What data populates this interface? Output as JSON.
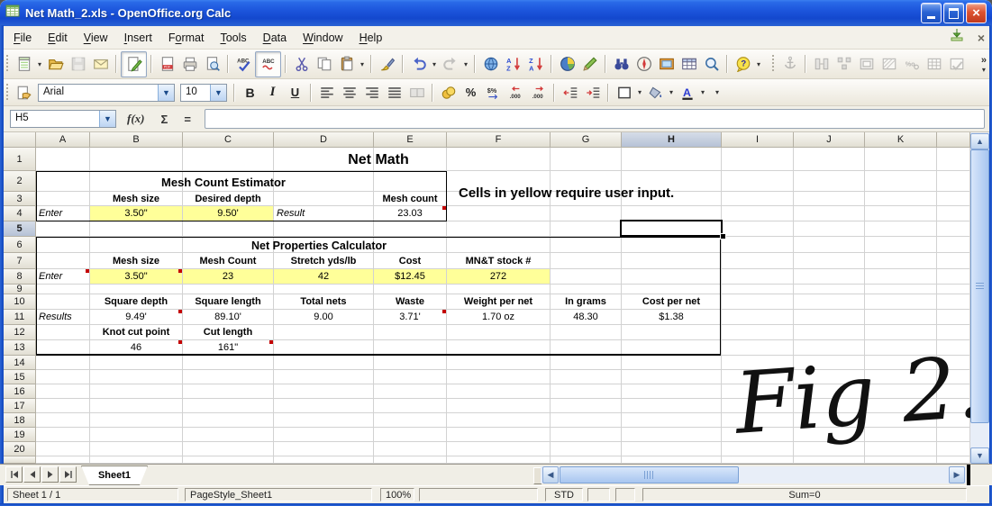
{
  "window": {
    "title": "Net Math_2.xls - OpenOffice.org Calc"
  },
  "titlebar": {
    "buttons": [
      "minimize",
      "maximize",
      "close"
    ]
  },
  "menu": {
    "items": [
      {
        "label": "File",
        "accel": 0
      },
      {
        "label": "Edit",
        "accel": 0
      },
      {
        "label": "View",
        "accel": 0
      },
      {
        "label": "Insert",
        "accel": 0
      },
      {
        "label": "Format",
        "accel": 1
      },
      {
        "label": "Tools",
        "accel": 0
      },
      {
        "label": "Data",
        "accel": 0
      },
      {
        "label": "Window",
        "accel": 0
      },
      {
        "label": "Help",
        "accel": 0
      }
    ]
  },
  "standard_toolbar": {
    "icons": [
      "new-document",
      "open",
      "save",
      "email",
      "edit-file",
      "export-pdf",
      "print",
      "page-preview",
      "spellcheck",
      "auto-spellcheck",
      "cut",
      "copy",
      "paste",
      "format-paintbrush",
      "undo",
      "redo",
      "hyperlink",
      "sort-ascending",
      "sort-descending",
      "insert-chart",
      "show-draw-functions",
      "find-replace",
      "navigator",
      "gallery",
      "data-sources",
      "zoom",
      "help"
    ],
    "disabled_icons": [
      "anchor",
      "insert-columns",
      "group",
      "insert-frame",
      "hatching",
      "decimals",
      "table",
      "design-mode"
    ]
  },
  "formatting_toolbar": {
    "font_name": "Arial",
    "font_size": "10",
    "bold_label": "B",
    "italic_label": "I",
    "underline_label": "U",
    "percent_label": "%",
    "icons": [
      "styles",
      "font-name",
      "font-size",
      "bold",
      "italic",
      "underline",
      "align-left",
      "align-center",
      "align-right",
      "justified",
      "merge-cells",
      "currency",
      "percent",
      "number-format-standard",
      "add-decimal",
      "delete-decimal",
      "decrease-indent",
      "increase-indent",
      "borders",
      "background-color",
      "font-color"
    ]
  },
  "formula_bar": {
    "cell_reference": "H5",
    "fx_label": "f(x)",
    "sum_label": "Σ",
    "equals_label": "=",
    "formula": ""
  },
  "grid": {
    "column_headers": [
      "A",
      "B",
      "C",
      "D",
      "E",
      "F",
      "G",
      "H",
      "I",
      "J",
      "K"
    ],
    "row_headers": [
      "1",
      "2",
      "3",
      "4",
      "5",
      "6",
      "7",
      "8",
      "9",
      "10",
      "11",
      "12",
      "13",
      "14",
      "15",
      "16",
      "17",
      "18",
      "19",
      "20"
    ],
    "selected_cell": "H5",
    "selected_column": "H",
    "selected_row": "5"
  },
  "sheet_content": {
    "net_math_title": "Net Math",
    "estimator_title": "Mesh Count Estimator",
    "calculator_title": "Net Properties Calculator",
    "note": "Cells in yellow require user input.",
    "figure_label": "Fig 2.",
    "cells": [
      {
        "ref": "B3",
        "text": "Mesh size",
        "bold": true
      },
      {
        "ref": "C3",
        "text": "Desired depth",
        "bold": true
      },
      {
        "ref": "E3",
        "text": "Mesh count",
        "bold": true
      },
      {
        "ref": "A4",
        "text": "Enter",
        "italic": true,
        "align": "left"
      },
      {
        "ref": "B4",
        "text": "3.50\"",
        "yellow": true
      },
      {
        "ref": "C4",
        "text": "9.50'",
        "yellow": true
      },
      {
        "ref": "D4",
        "text": "Result",
        "italic": true,
        "align": "left"
      },
      {
        "ref": "E4",
        "text": "23.03",
        "comment": true
      },
      {
        "ref": "B7",
        "text": "Mesh size",
        "bold": true
      },
      {
        "ref": "C7",
        "text": "Mesh Count",
        "bold": true
      },
      {
        "ref": "D7",
        "text": "Stretch yds/lb",
        "bold": true
      },
      {
        "ref": "E7",
        "text": "Cost",
        "bold": true
      },
      {
        "ref": "F7",
        "text": "MN&T stock #",
        "bold": true
      },
      {
        "ref": "A8",
        "text": "Enter",
        "italic": true,
        "align": "left",
        "comment": true
      },
      {
        "ref": "B8",
        "text": "3.50\"",
        "yellow": true,
        "comment": true
      },
      {
        "ref": "C8",
        "text": "23",
        "yellow": true
      },
      {
        "ref": "D8",
        "text": "42",
        "yellow": true
      },
      {
        "ref": "E8",
        "text": "$12.45",
        "yellow": true
      },
      {
        "ref": "F8",
        "text": "272",
        "yellow": true
      },
      {
        "ref": "B10",
        "text": "Square depth",
        "bold": true
      },
      {
        "ref": "C10",
        "text": "Square length",
        "bold": true
      },
      {
        "ref": "D10",
        "text": "Total nets",
        "bold": true
      },
      {
        "ref": "E10",
        "text": "Waste",
        "bold": true
      },
      {
        "ref": "F10",
        "text": "Weight per net",
        "bold": true
      },
      {
        "ref": "G10",
        "text": "In grams",
        "bold": true
      },
      {
        "ref": "H10",
        "text": "Cost per net",
        "bold": true
      },
      {
        "ref": "A11",
        "text": "Results",
        "italic": true,
        "align": "left"
      },
      {
        "ref": "B11",
        "text": "9.49'",
        "comment": true
      },
      {
        "ref": "C11",
        "text": "89.10'"
      },
      {
        "ref": "D11",
        "text": "9.00"
      },
      {
        "ref": "E11",
        "text": "3.71'",
        "comment": true
      },
      {
        "ref": "F11",
        "text": "1.70 oz"
      },
      {
        "ref": "G11",
        "text": "48.30"
      },
      {
        "ref": "H11",
        "text": "$1.38"
      },
      {
        "ref": "B12",
        "text": "Knot cut point",
        "bold": true
      },
      {
        "ref": "C12",
        "text": "Cut length",
        "bold": true
      },
      {
        "ref": "B13",
        "text": "46",
        "comment": true
      },
      {
        "ref": "C13",
        "text": "161\"",
        "comment": true
      }
    ]
  },
  "colors": {
    "input_highlight": "#ffff99",
    "comment_marker": "#c40000",
    "selection_border": "#000000"
  },
  "sheet_tabs": {
    "tabs": [
      "Sheet1"
    ],
    "active": "Sheet1"
  },
  "status_bar": {
    "sheet_position": "Sheet 1 / 1",
    "page_style": "PageStyle_Sheet1",
    "zoom": "100%",
    "mode": "STD",
    "sum": "Sum=0"
  }
}
